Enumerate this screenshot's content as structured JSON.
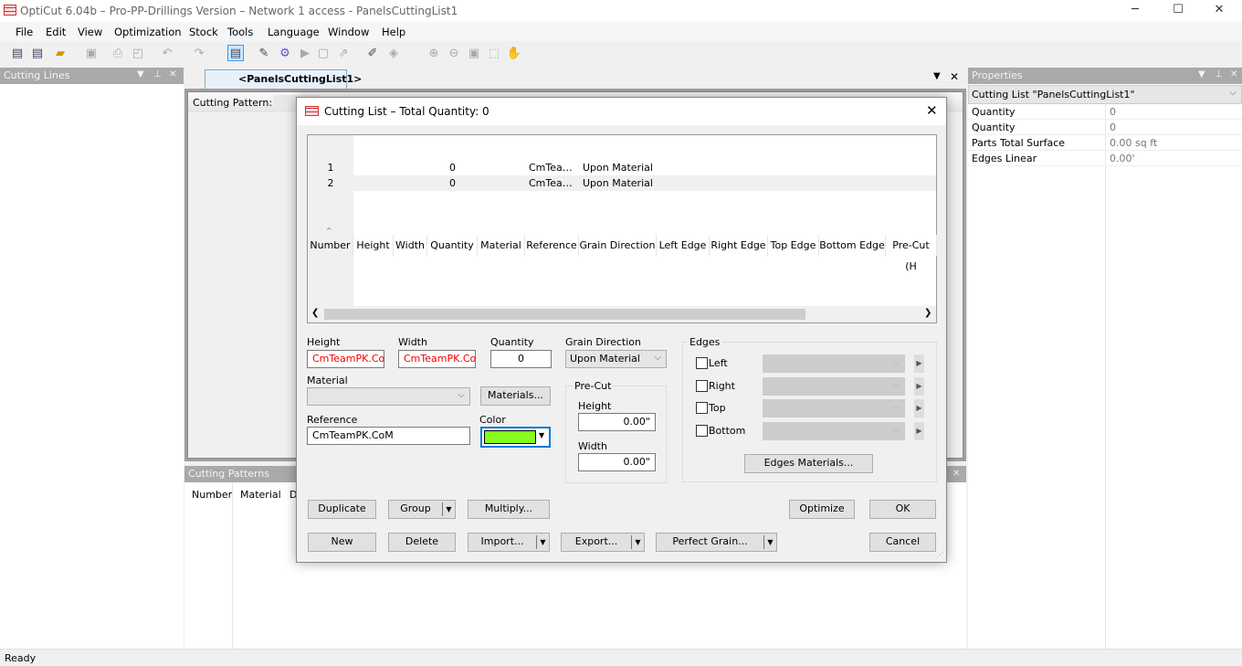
{
  "app": {
    "title": "OptiCut 6.04b – Pro-PP-Drillings Version – Network 1 access - PanelsCuttingList1",
    "icon": "grid-app-icon"
  },
  "window_controls": {
    "minimize": "─",
    "maximize": "☐",
    "close": "✕"
  },
  "menu": [
    "File",
    "Edit",
    "View",
    "Optimization",
    "Stock",
    "Tools",
    "Language",
    "Window",
    "Help"
  ],
  "toolbar": [
    "new-icon",
    "new-list-icon",
    "open-icon",
    "save-icon",
    "print-icon",
    "print-preview-icon",
    "undo-icon",
    "redo-icon",
    "cutting-list-icon",
    "edit-icon",
    "gear-icon",
    "play-icon",
    "report-icon",
    "export-icon",
    "pencil-icon",
    "layers-icon",
    "zoom-in-icon",
    "zoom-out-icon",
    "zoom-fit-icon",
    "zoom-select-icon",
    "hand-icon"
  ],
  "left_panel": {
    "title": "Cutting Lines"
  },
  "doc_tab": {
    "label": "<PanelsCuttingList1>",
    "cutting_pattern_label": "Cutting Pattern:"
  },
  "patterns_panel": {
    "title": "Cutting Patterns",
    "columns": [
      "Number",
      "Material",
      "D"
    ]
  },
  "properties": {
    "title": "Properties",
    "selector": "Cutting List \"PanelsCuttingList1\"",
    "rows": [
      {
        "name": "Quantity",
        "value": "0"
      },
      {
        "name": "Quantity",
        "value": "0"
      },
      {
        "name": "Parts Total Surface",
        "value": "0.00 sq ft"
      },
      {
        "name": "Edges Linear",
        "value": "0.00'"
      }
    ]
  },
  "dialog": {
    "title": "Cutting List – Total Quantity: 0",
    "columns": [
      "Number",
      "Height",
      "Width",
      "Quantity",
      "Material",
      "Reference",
      "Grain Direction",
      "Left Edge",
      "Right Edge",
      "Top Edge",
      "Bottom Edge",
      "Pre-Cut (H"
    ],
    "rows": [
      {
        "number": "1",
        "height": "",
        "width": "",
        "quantity": "0",
        "material": "",
        "reference": "CmTea…",
        "grain": "Upon Material"
      },
      {
        "number": "2",
        "height": "",
        "width": "",
        "quantity": "0",
        "material": "",
        "reference": "CmTea…",
        "grain": "Upon Material"
      }
    ],
    "form": {
      "height_label": "Height",
      "height_value": "CmTeamPK.Co",
      "width_label": "Width",
      "width_value": "CmTeamPK.Co",
      "quantity_label": "Quantity",
      "quantity_value": "0",
      "grain_label": "Grain Direction",
      "grain_value": "Upon Material",
      "material_label": "Material",
      "material_value": "",
      "materials_button": "Materials...",
      "reference_label": "Reference",
      "reference_value": "CmTeamPK.CoM",
      "color_label": "Color",
      "color_value": "#84fc1c",
      "precut_label": "Pre-Cut",
      "precut_height_label": "Height",
      "precut_height": "0.00\"",
      "precut_width_label": "Width",
      "precut_width": "0.00\"",
      "edges_label": "Edges",
      "edges": [
        "Left",
        "Right",
        "Top",
        "Bottom"
      ],
      "edges_materials_button": "Edges Materials..."
    },
    "buttons": {
      "duplicate": "Duplicate",
      "group": "Group",
      "multiply": "Multiply...",
      "optimize": "Optimize",
      "ok": "OK",
      "new": "New",
      "delete": "Delete",
      "import": "Import...",
      "export": "Export...",
      "perfect_grain": "Perfect Grain...",
      "cancel": "Cancel"
    }
  },
  "status": "Ready"
}
